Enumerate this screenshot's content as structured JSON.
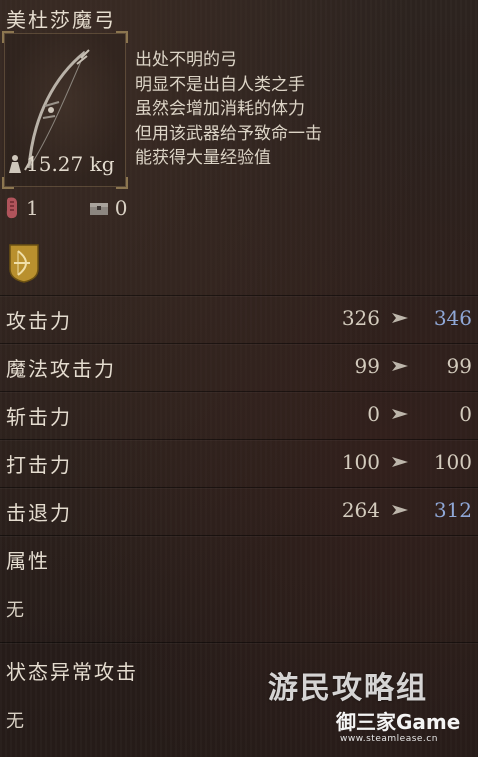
{
  "item": {
    "name": "美杜莎魔弓",
    "weight": "15.27 kg",
    "icon": "bow-icon",
    "description": [
      "出处不明的弓",
      "明显不是出自人类之手",
      "虽然会增加消耗的体力",
      "但用该武器给予致命一击",
      "能获得大量经验值"
    ]
  },
  "counts": {
    "hand": "1",
    "chest": "0"
  },
  "skill_icon": "bow-skill-badge-icon",
  "stats": [
    {
      "label": "攻击力",
      "current": "326",
      "new": "346",
      "up": true
    },
    {
      "label": "魔法攻击力",
      "current": "99",
      "new": "99",
      "up": false
    },
    {
      "label": "斩击力",
      "current": "0",
      "new": "0",
      "up": false
    },
    {
      "label": "打击力",
      "current": "100",
      "new": "100",
      "up": false
    },
    {
      "label": "击退力",
      "current": "264",
      "new": "312",
      "up": true
    }
  ],
  "attribute": {
    "label": "属性",
    "value": "无"
  },
  "status_attack": {
    "label": "状态异常攻击",
    "value": "无"
  },
  "watermarks": {
    "site": "游民攻略组",
    "brand": "御三家Game",
    "url": "www.steamlease.cn"
  },
  "colors": {
    "increase": "#8fa7d6",
    "text": "#d9d1c4",
    "background": "#2a211d"
  }
}
